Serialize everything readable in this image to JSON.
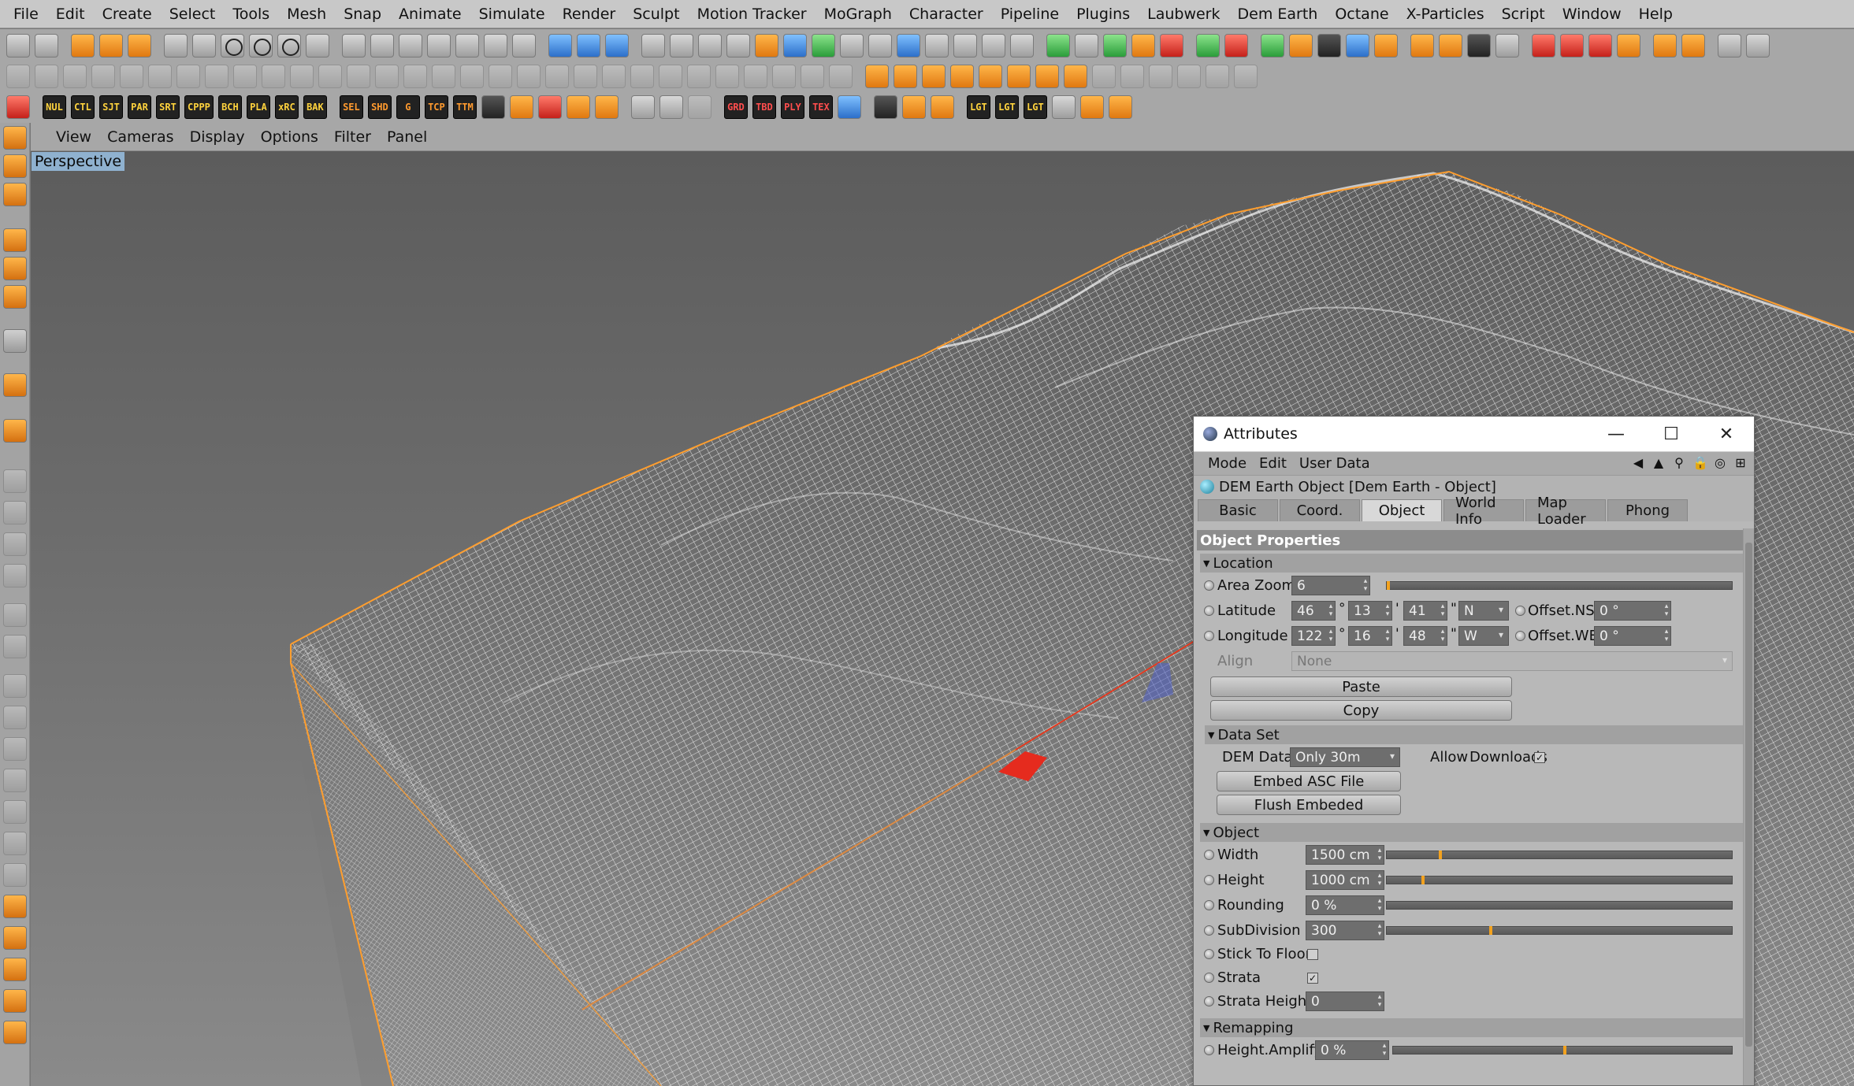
{
  "menubar": {
    "items": [
      "File",
      "Edit",
      "Create",
      "Select",
      "Tools",
      "Mesh",
      "Snap",
      "Animate",
      "Simulate",
      "Render",
      "Sculpt",
      "Motion Tracker",
      "MoGraph",
      "Character",
      "Pipeline",
      "Plugins",
      "Laubwerk",
      "Dem Earth",
      "Octane",
      "X-Particles",
      "Script",
      "Window",
      "Help"
    ]
  },
  "toolbar3": {
    "tags_a": [
      "NUL",
      "CTL",
      "SJT",
      "PAR",
      "SRT",
      "CPPP",
      "BCH",
      "PLA",
      "xRC",
      "BAK"
    ],
    "tags_b": [
      "SEL",
      "SHD",
      "G",
      "TCP",
      "TTM"
    ],
    "tags_c": [
      "GRD",
      "TBD",
      "PLY",
      "TEX"
    ],
    "tags_d": [
      "LGT",
      "LGT",
      "LGT"
    ]
  },
  "viewport": {
    "menu": [
      "View",
      "Cameras",
      "Display",
      "Options",
      "Filter",
      "Panel"
    ],
    "label": "Perspective"
  },
  "attributes": {
    "window_title": "Attributes",
    "controls": {
      "minimize": "—",
      "maximize": "☐",
      "close": "✕"
    },
    "menu": [
      "Mode",
      "Edit",
      "User Data"
    ],
    "object_name": "DEM Earth Object [Dem Earth - Object]",
    "tabs": [
      "Basic",
      "Coord.",
      "Object",
      "World Info",
      "Map Loader",
      "Phong"
    ],
    "active_tab": "Object",
    "section_title": "Object Properties",
    "location": {
      "header": "Location",
      "area_zoom_label": "Area Zoom",
      "area_zoom_value": "6",
      "area_zoom_fraction": 0.0,
      "latitude_label": "Latitude",
      "latitude": {
        "deg": "46",
        "min": "13",
        "sec": "41",
        "hemi": "N"
      },
      "offset_ns_label": "Offset.NS",
      "offset_ns_value": "0 °",
      "longitude_label": "Longitude",
      "longitude": {
        "deg": "122",
        "min": "16",
        "sec": "48",
        "hemi": "W"
      },
      "offset_we_label": "Offset.WE",
      "offset_we_value": "0 °",
      "align_label": "Align",
      "align_value": "None",
      "paste_label": "Paste",
      "copy_label": "Copy"
    },
    "dataset": {
      "header": "Data Set",
      "dem_data_label": "DEM Data",
      "dem_data_value": "Only 30m",
      "allow_label": "Allow",
      "downloads_label": "Downloads",
      "embed_label": "Embed ASC File",
      "flush_label": "Flush Embeded"
    },
    "object": {
      "header": "Object",
      "width_label": "Width",
      "width_value": "1500 cm",
      "height_label": "Height",
      "height_value": "1000 cm",
      "rounding_label": "Rounding",
      "rounding_value": "0 %",
      "subdivision_label": "SubDivision",
      "subdivision_value": "300",
      "stick_label": "Stick To Floor",
      "strata_label": "Strata",
      "strata_height_label": "Strata Height",
      "strata_height_value": "0"
    },
    "remapping": {
      "header": "Remapping",
      "height_amplify_label": "Height.Amplify",
      "height_amplify_value": "0 %"
    }
  },
  "colors": {
    "accent_orange": "#f3a21e",
    "axis_x": "#e52b1e",
    "axis_y": "#2fd02f",
    "selection_outline": "#ff9e2e"
  }
}
